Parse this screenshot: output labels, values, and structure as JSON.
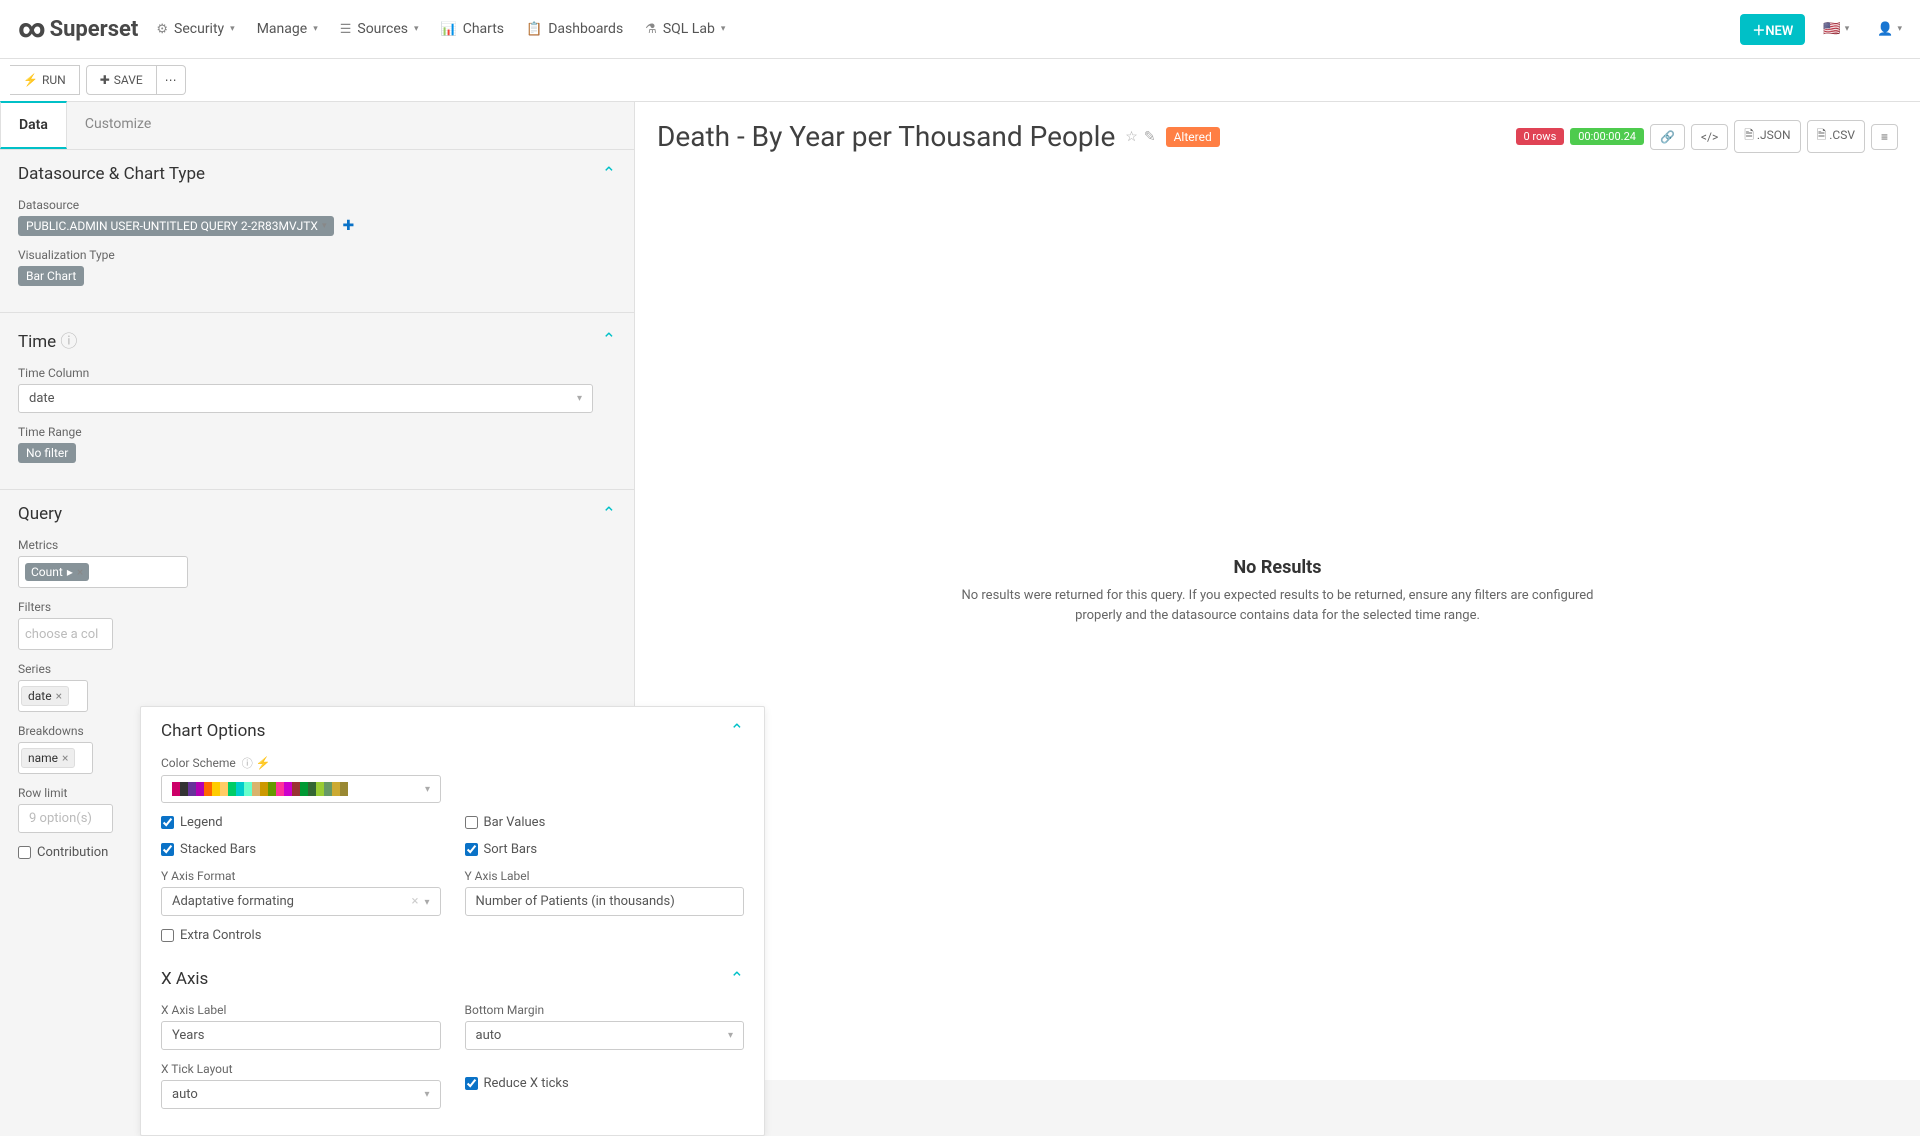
{
  "brand": "Superset",
  "nav": {
    "security": "Security",
    "manage": "Manage",
    "sources": "Sources",
    "charts": "Charts",
    "dashboards": "Dashboards",
    "sqllab": "SQL Lab"
  },
  "new_btn": "NEW",
  "toolbar": {
    "run": "RUN",
    "save": "SAVE"
  },
  "chart": {
    "title": "Death - By Year per Thousand People",
    "altered": "Altered",
    "rows_pill": "0 rows",
    "time_pill": "00:00:00.24",
    "json_btn": ".JSON",
    "csv_btn": ".CSV"
  },
  "no_results": {
    "heading": "No Results",
    "body": "No results were returned for this query. If you expected results to be returned, ensure any filters are configured properly and the datasource contains data for the selected time range."
  },
  "tabs": {
    "data": "Data",
    "customize": "Customize"
  },
  "sections": {
    "datasource_head": "Datasource & Chart Type",
    "datasource_label": "Datasource",
    "datasource_value": "PUBLIC.ADMIN USER-UNTITLED QUERY 2-2R83MVJTX",
    "viztype_label": "Visualization Type",
    "viztype_value": "Bar Chart",
    "time_head": "Time",
    "time_col_label": "Time Column",
    "time_col_value": "date",
    "time_range_label": "Time Range",
    "time_range_value": "No filter",
    "query_head": "Query",
    "metrics_label": "Metrics",
    "metrics_value": "Count",
    "filters_label": "Filters",
    "filters_placeholder": "choose a col",
    "series_label": "Series",
    "series_value": "date",
    "breakdowns_label": "Breakdowns",
    "breakdowns_value": "name",
    "rowlimit_label": "Row limit",
    "rowlimit_placeholder": "9 option(s)",
    "contribution_label": "Contribution"
  },
  "popup": {
    "chart_options_head": "Chart Options",
    "color_scheme_label": "Color Scheme",
    "legend": "Legend",
    "bar_values": "Bar Values",
    "stacked": "Stacked Bars",
    "sort_bars": "Sort Bars",
    "y_format_label": "Y Axis Format",
    "y_format_value": "Adaptative formating",
    "y_label_label": "Y Axis Label",
    "y_label_value": "Number of Patients (in thousands)",
    "extra": "Extra Controls",
    "xaxis_head": "X Axis",
    "x_label_label": "X Axis Label",
    "x_label_value": "Years",
    "bottom_margin_label": "Bottom Margin",
    "bottom_margin_value": "auto",
    "x_tick_label": "X Tick Layout",
    "x_tick_value": "auto",
    "reduce_x": "Reduce X ticks"
  },
  "swatches": [
    "#cc0068",
    "#333333",
    "#663399",
    "#b300b3",
    "#ff6600",
    "#ffcc00",
    "#ffcc66",
    "#00cc66",
    "#00cccc",
    "#66ffcc",
    "#d9b36c",
    "#cc9900",
    "#669900",
    "#ff3399",
    "#cc00cc",
    "#993333",
    "#009933",
    "#336633",
    "#99cc33",
    "#669966",
    "#ccaa33",
    "#998833"
  ]
}
